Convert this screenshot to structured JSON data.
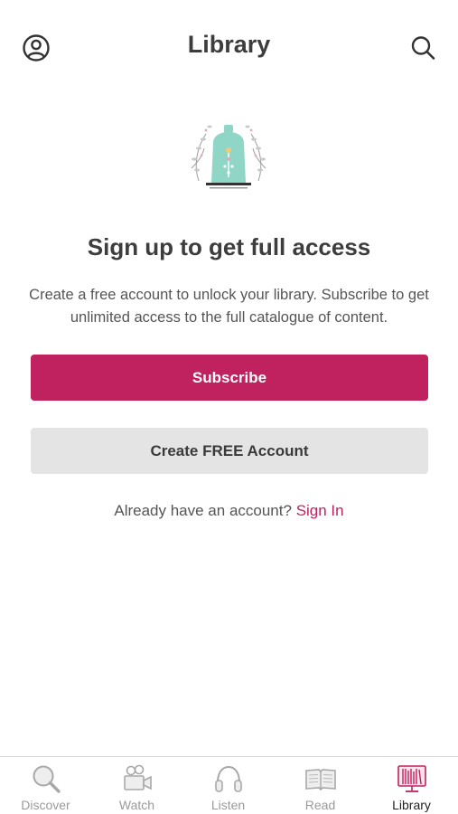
{
  "header": {
    "title": "Library",
    "profile_icon": "user-circle-icon",
    "search_icon": "search-icon"
  },
  "main": {
    "headline": "Sign up to get full access",
    "description": "Create a free account to unlock your library. Subscribe to get unlimited access to the full catalogue of content.",
    "subscribe_label": "Subscribe",
    "create_account_label": "Create FREE Account",
    "signin_prompt": "Already have an account?",
    "signin_link": "Sign In"
  },
  "tabbar": {
    "items": [
      {
        "label": "Discover",
        "icon": "magnifier-icon",
        "active": false
      },
      {
        "label": "Watch",
        "icon": "video-camera-icon",
        "active": false
      },
      {
        "label": "Listen",
        "icon": "headphones-icon",
        "active": false
      },
      {
        "label": "Read",
        "icon": "open-book-icon",
        "active": false
      },
      {
        "label": "Library",
        "icon": "bookshelf-icon",
        "active": true
      }
    ]
  },
  "colors": {
    "accent": "#c0225f",
    "secondary_button": "#e4e4e4",
    "illustration_teal": "#8fd6c6"
  }
}
